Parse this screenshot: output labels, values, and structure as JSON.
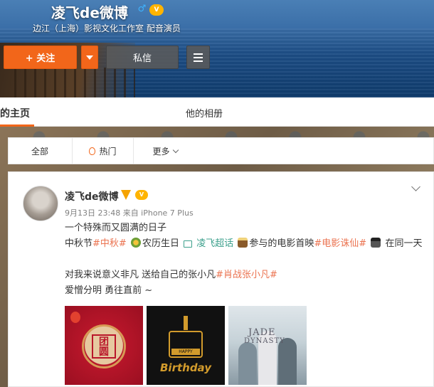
{
  "profile": {
    "name": "凌飞de微博",
    "gender_symbol": "♂",
    "bio": "边江（上海）影视文化工作室 配音演员",
    "follow_label": "+ 关注",
    "message_label": "私信"
  },
  "profile_tabs": {
    "home": "的主页",
    "album": "他的相册"
  },
  "filter_tabs": {
    "all": "全部",
    "hot": "热门",
    "more": "更多"
  },
  "post": {
    "author": "凌飞de微博",
    "meta": "9月13日 23:48 来自 iPhone 7 Plus",
    "line1": "一个特殊而又圆满的日子",
    "line2_a": "中秋节",
    "tag_midautumn": "#中秋#",
    "line2_b": "农历生日 ",
    "supertopic": "凌飞超话",
    "line2_c": "参与的电影首映",
    "tag_movie": "#电影诛仙#",
    "line2_d": "在同一天",
    "line3_a": "对我来说意义非凡 送给自己的张小凡",
    "tag_xiaofan": "#肖战张小凡#",
    "line4": "爱憎分明 勇往直前 ~",
    "pic1_text": "团 圆",
    "pic2_happy": "HAPPY",
    "pic2_text": "Birthday",
    "pic3_title": "JADE",
    "pic3_sub": "DYNASTY"
  },
  "colors": {
    "accent": "#f2661a",
    "tag": "#eb7350",
    "link": "#3ca08c"
  }
}
